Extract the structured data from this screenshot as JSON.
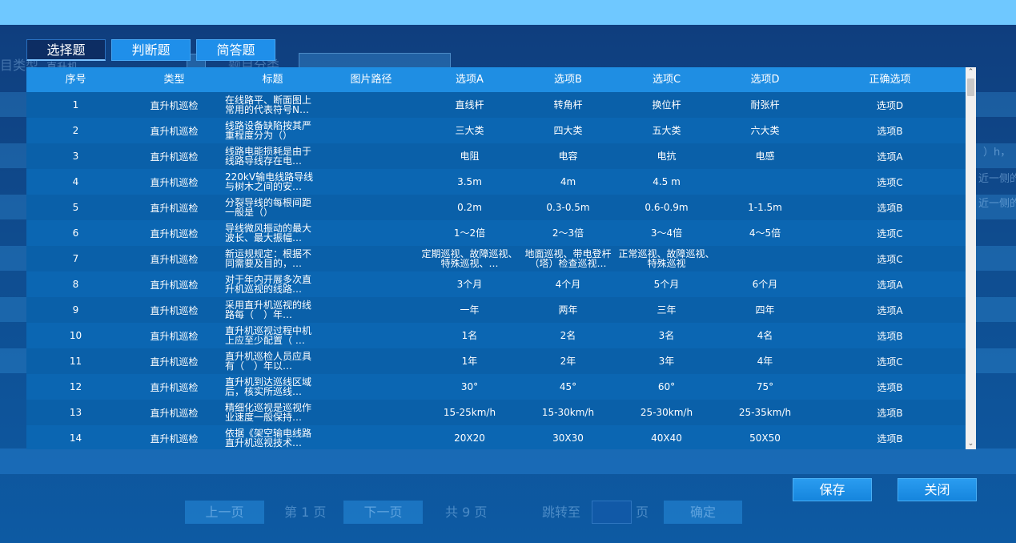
{
  "tabs": [
    {
      "label": "选择题",
      "active": true
    },
    {
      "label": "判断题",
      "active": false
    },
    {
      "label": "简答题",
      "active": false
    }
  ],
  "background_form": {
    "subject_type_label": "目类型",
    "subject_type_value": "直升机",
    "category_label": "题目分类"
  },
  "table": {
    "columns": [
      "序号",
      "类型",
      "标题",
      "图片路径",
      "选项A",
      "选项B",
      "选项C",
      "选项D",
      "正确选项"
    ],
    "rows": [
      {
        "no": "1",
        "type": "直升机巡检",
        "title": "在线路平、断面图上常用的代表符号N…",
        "img": "",
        "a": "直线杆",
        "b": "转角杆",
        "c": "换位杆",
        "d": "耐张杆",
        "answer": "选项D"
      },
      {
        "no": "2",
        "type": "直升机巡检",
        "title": "线路设备缺陷按其严重程度分为（）",
        "img": "",
        "a": "三大类",
        "b": "四大类",
        "c": "五大类",
        "d": "六大类",
        "answer": "选项B"
      },
      {
        "no": "3",
        "type": "直升机巡检",
        "title": "线路电能损耗是由于线路导线存在电…",
        "img": "",
        "a": "电阻",
        "b": "电容",
        "c": "电抗",
        "d": "电感",
        "answer": "选项A"
      },
      {
        "no": "4",
        "type": "直升机巡检",
        "title": "220kV输电线路导线与树木之间的安…",
        "img": "",
        "a": "3.5m",
        "b": "4m",
        "c": "4.5 m",
        "d": "",
        "answer": "选项C"
      },
      {
        "no": "5",
        "type": "直升机巡检",
        "title": "分裂导线的每根间距一般是（）",
        "img": "",
        "a": "0.2m",
        "b": "0.3-0.5m",
        "c": "0.6-0.9m",
        "d": "1-1.5m",
        "answer": "选项B"
      },
      {
        "no": "6",
        "type": "直升机巡检",
        "title": "导线微风振动的最大波长、最大振幅…",
        "img": "",
        "a": "1～2倍",
        "b": "2～3倍",
        "c": "3～4倍",
        "d": "4～5倍",
        "answer": "选项C"
      },
      {
        "no": "7",
        "type": "直升机巡检",
        "title": "新运规规定：根据不同需要及目的，…",
        "img": "",
        "a": "定期巡视、故障巡视、特殊巡视、…",
        "b": "地面巡视、带电登杆（塔）检查巡视…",
        "c": "正常巡视、故障巡视、特殊巡视",
        "d": "",
        "answer": "选项C"
      },
      {
        "no": "8",
        "type": "直升机巡检",
        "title": "对于年内开展多次直升机巡视的线路…",
        "img": "",
        "a": "3个月",
        "b": "4个月",
        "c": "5个月",
        "d": "6个月",
        "answer": "选项A"
      },
      {
        "no": "9",
        "type": "直升机巡检",
        "title": "采用直升机巡视的线路每（　）年…",
        "img": "",
        "a": "一年",
        "b": "两年",
        "c": "三年",
        "d": "四年",
        "answer": "选项A"
      },
      {
        "no": "10",
        "type": "直升机巡检",
        "title": "直升机巡视过程中机上应至少配置（ …",
        "img": "",
        "a": "1名",
        "b": "2名",
        "c": "3名",
        "d": "4名",
        "answer": "选项B"
      },
      {
        "no": "11",
        "type": "直升机巡检",
        "title": "直升机巡检人员应具有（　）年以…",
        "img": "",
        "a": "1年",
        "b": "2年",
        "c": "3年",
        "d": "4年",
        "answer": "选项C"
      },
      {
        "no": "12",
        "type": "直升机巡检",
        "title": "直升机到达巡线区域后，核实所巡线…",
        "img": "",
        "a": "30°",
        "b": "45°",
        "c": "60°",
        "d": "75°",
        "answer": "选项B"
      },
      {
        "no": "13",
        "type": "直升机巡检",
        "title": "精细化巡视是巡视作业速度一般保持…",
        "img": "",
        "a": "15-25km/h",
        "b": "15-30km/h",
        "c": "25-30km/h",
        "d": "25-35km/h",
        "answer": "选项B"
      },
      {
        "no": "14",
        "type": "直升机巡检",
        "title": "依据《架空输电线路直升机巡视技术…",
        "img": "",
        "a": "20X20",
        "b": "30X30",
        "c": "40X40",
        "d": "50X50",
        "answer": "选项B"
      }
    ]
  },
  "buttons": {
    "save": "保存",
    "close": "关闭"
  },
  "pager": {
    "prev": "上一页",
    "page_info": "第 1 页",
    "next": "下一页",
    "total": "共 9 页",
    "jump_label": "跳转至",
    "page_unit": "页",
    "confirm": "确定"
  },
  "bg_fragments": {
    "r1": "）h，",
    "r2": "近一侧的",
    "r3": "近一侧的"
  }
}
